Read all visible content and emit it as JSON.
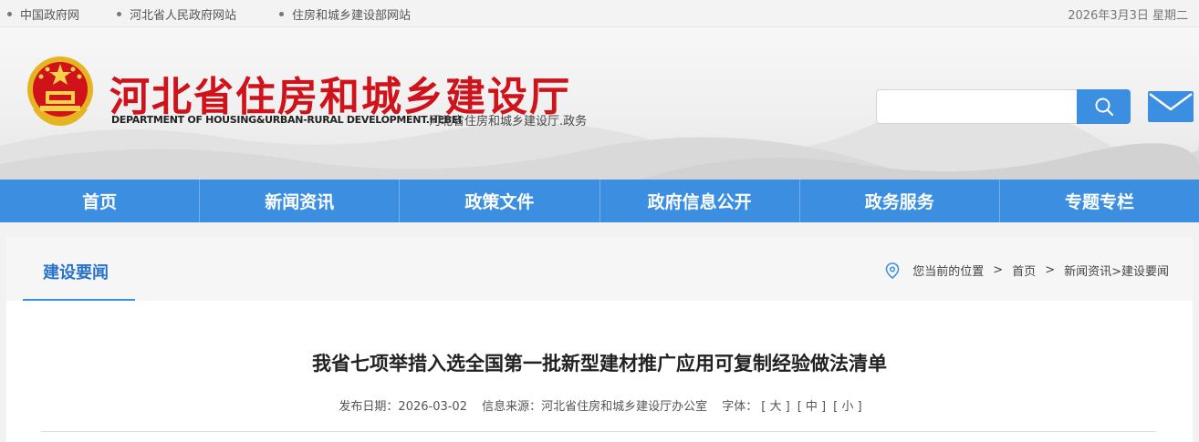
{
  "topbar": {
    "links": [
      "中国政府网",
      "河北省人民政府网站",
      "住房和城乡建设部网站"
    ],
    "date": "2026年3月3日 星期二"
  },
  "header": {
    "title": "河北省住房和城乡建设厅",
    "title_en": "DEPARTMENT OF HOUSING&URBAN-RURAL DEVELOPMENT.HEBEI",
    "subtitle": "河北省住房和城乡建设厅.政务",
    "search_placeholder": "",
    "icons": {
      "emblem": "national-emblem-icon",
      "search": "search-icon",
      "mail": "mail-icon"
    },
    "colors": {
      "title": "#d0121b",
      "accent": "#3b8ee0"
    }
  },
  "nav": {
    "items": [
      "首页",
      "新闻资讯",
      "政策文件",
      "政府信息公开",
      "政务服务",
      "专题专栏"
    ]
  },
  "section": {
    "title": "建设要闻",
    "breadcrumb": {
      "prefix": "您当前的位置",
      "sep": ">",
      "home": "首页",
      "path": "新闻资讯>建设要闻"
    }
  },
  "article": {
    "title": "我省七项举措入选全国第一批新型建材推广应用可复制经验做法清单",
    "date": "发布日期：2026-03-02",
    "source": "信息来源：河北省住房和城乡建设厅办公室",
    "font_label": "字体：",
    "font_large": "[ 大 ]",
    "font_medium": "[ 中 ]",
    "font_small": "[ 小 ]"
  }
}
